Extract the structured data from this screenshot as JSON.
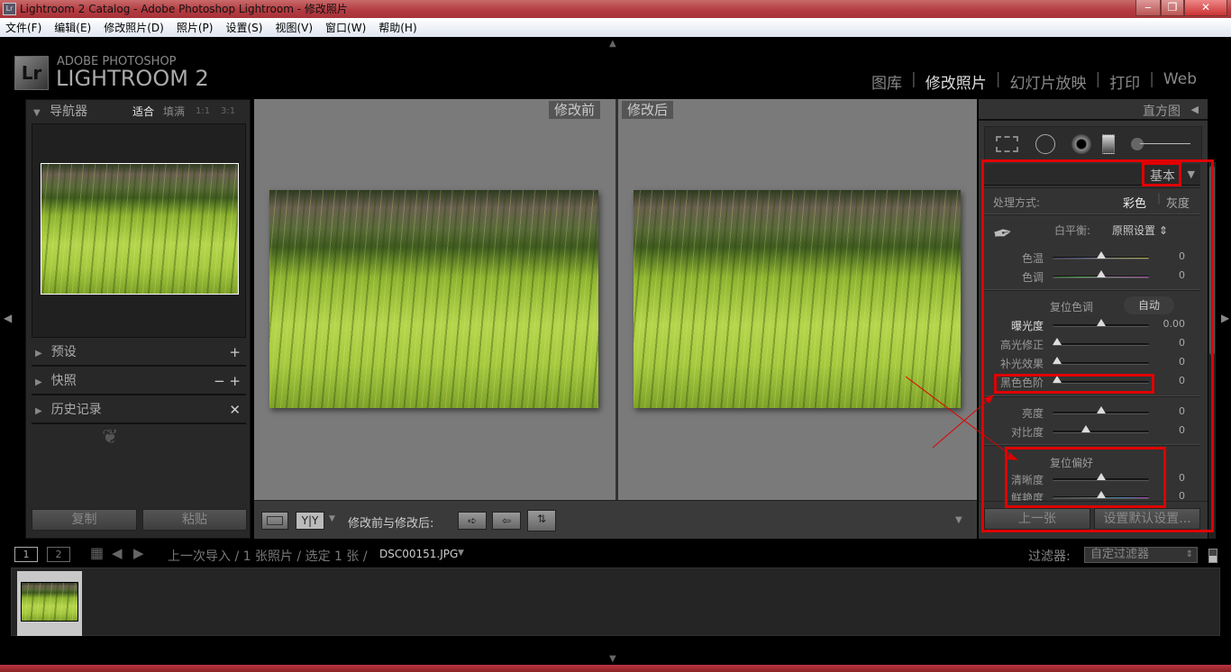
{
  "window": {
    "title": "Lightroom 2 Catalog - Adobe Photoshop Lightroom - 修改照片",
    "icon": "Lr",
    "min": "‒",
    "max": "❐",
    "close": "✕"
  },
  "menu": [
    "文件(F)",
    "编辑(E)",
    "修改照片(D)",
    "照片(P)",
    "设置(S)",
    "视图(V)",
    "窗口(W)",
    "帮助(H)"
  ],
  "logo": {
    "mark": "Lr",
    "line1": "ADOBE PHOTOSHOP",
    "line2": "LIGHTROOM 2"
  },
  "modules": [
    {
      "label": "图库"
    },
    {
      "label": "修改照片",
      "active": true
    },
    {
      "label": "幻灯片放映"
    },
    {
      "label": "打印"
    },
    {
      "label": "Web"
    }
  ],
  "left": {
    "navigator": {
      "title": "导航器",
      "zoom": [
        "适合",
        "填满",
        "1:1",
        "3:1"
      ]
    },
    "sections": [
      {
        "title": "预设",
        "actions": "+"
      },
      {
        "title": "快照",
        "actions": "− +"
      },
      {
        "title": "历史记录",
        "actions": "✕"
      }
    ],
    "copy": "复制",
    "paste": "粘贴"
  },
  "view": {
    "before": "修改前",
    "after": "修改后"
  },
  "toolbar": {
    "yy": "Y|Y",
    "label": "修改前与修改后:"
  },
  "right": {
    "histogram": "直方图",
    "basic": "基本",
    "treatment": {
      "label": "处理方式:",
      "color": "彩色",
      "gray": "灰度"
    },
    "wb": {
      "label": "白平衡:",
      "value": "原照设置"
    },
    "tone_reset": "复位色调",
    "auto": "自动",
    "presence_reset": "复位偏好",
    "sliders": [
      {
        "label": "色温",
        "value": "0",
        "pos": 0.5,
        "track": "temp"
      },
      {
        "label": "色调",
        "value": "0",
        "pos": 0.5,
        "track": "tint"
      },
      {
        "label": "曝光度",
        "value": "0.00",
        "pos": 0.5,
        "hi": true
      },
      {
        "label": "高光修正",
        "value": "0",
        "pos": 0
      },
      {
        "label": "补光效果",
        "value": "0",
        "pos": 0
      },
      {
        "label": "黑色色阶",
        "value": "0",
        "pos": 0
      },
      {
        "label": "亮度",
        "value": "0",
        "pos": 0.5
      },
      {
        "label": "对比度",
        "value": "0",
        "pos": 0.33
      },
      {
        "label": "清晰度",
        "value": "0",
        "pos": 0.5
      },
      {
        "label": "鲜艳度",
        "value": "0",
        "pos": 0.5,
        "track": "vib"
      }
    ],
    "prev": "上一张",
    "set_default": "设置默认设置..."
  },
  "filmstrip": {
    "breadcrumb": "上一次导入 / 1 张照片 / 选定 1 张 /",
    "file": "DSC00151.JPG",
    "filter_label": "过滤器:",
    "filter_value": "自定过滤器",
    "view1": "1",
    "view2": "2"
  },
  "colors": {
    "annotation": "#e00000",
    "panel": "#333333",
    "center": "#7a7a7a"
  }
}
